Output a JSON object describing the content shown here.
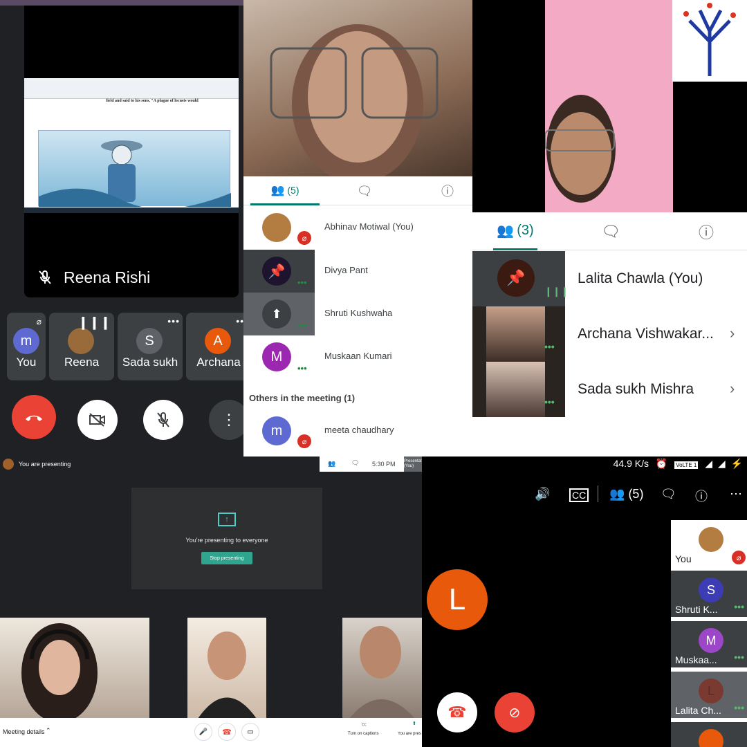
{
  "panel1": {
    "main_speaker": "Reena Rishi",
    "shared_text": "field and said to his sons, \"A plague of locusts would",
    "tiles": [
      {
        "initial": "m",
        "label": "You",
        "color": "#5e6ad2"
      },
      {
        "initial": "",
        "label": "Reena",
        "color": "#9a6b3a"
      },
      {
        "initial": "S",
        "label": "Sada sukh",
        "color": "#5f6368"
      },
      {
        "initial": "A",
        "label": "Archana",
        "color": "#e8590c"
      }
    ]
  },
  "panel2": {
    "people_count": "(5)",
    "participants": [
      {
        "name": "Abhinav Motiwal (You)",
        "initial": "",
        "muted": true
      },
      {
        "name": "Divya Pant",
        "initial": "",
        "muted": false
      },
      {
        "name": "Shruti Kushwaha",
        "initial": "",
        "muted": false
      },
      {
        "name": "Muskaan Kumari",
        "initial": "M",
        "muted": false
      }
    ],
    "others_heading": "Others in the meeting (1)",
    "others": [
      {
        "name": "meeta chaudhary",
        "initial": "m",
        "muted": true
      }
    ]
  },
  "panel3": {
    "people_count": "(3)",
    "participants": [
      {
        "name": "Lalita Chawla (You)"
      },
      {
        "name": "Archana Vishwakar..."
      },
      {
        "name": "Sada sukh Mishra"
      }
    ]
  },
  "panel4": {
    "banner": "You are presenting",
    "time": "5:30 PM",
    "presenting_tag": "Presentat (You)",
    "box_text": "You're presenting to everyone",
    "stop_label": "Stop presenting",
    "meeting_details": "Meeting details",
    "captions_label": "Turn on captions",
    "you_present_label": "You are pres"
  },
  "panel5": {
    "net_speed": "44.9 K/s",
    "carrier": "VoLTE 1",
    "people_count": "(5)",
    "main_initial": "L",
    "side": [
      {
        "name": "You",
        "initial": ""
      },
      {
        "name": "Shruti K...",
        "initial": "S",
        "color": "#3c3cb4"
      },
      {
        "name": "Muskaa...",
        "initial": "M",
        "color": "#9c46c8"
      },
      {
        "name": "Lalita Ch...",
        "initial": "L",
        "color": "#7a3a32"
      }
    ]
  },
  "colors": {
    "teal": "#00796b",
    "red": "#ea4335",
    "accent": "#1a73e8"
  }
}
